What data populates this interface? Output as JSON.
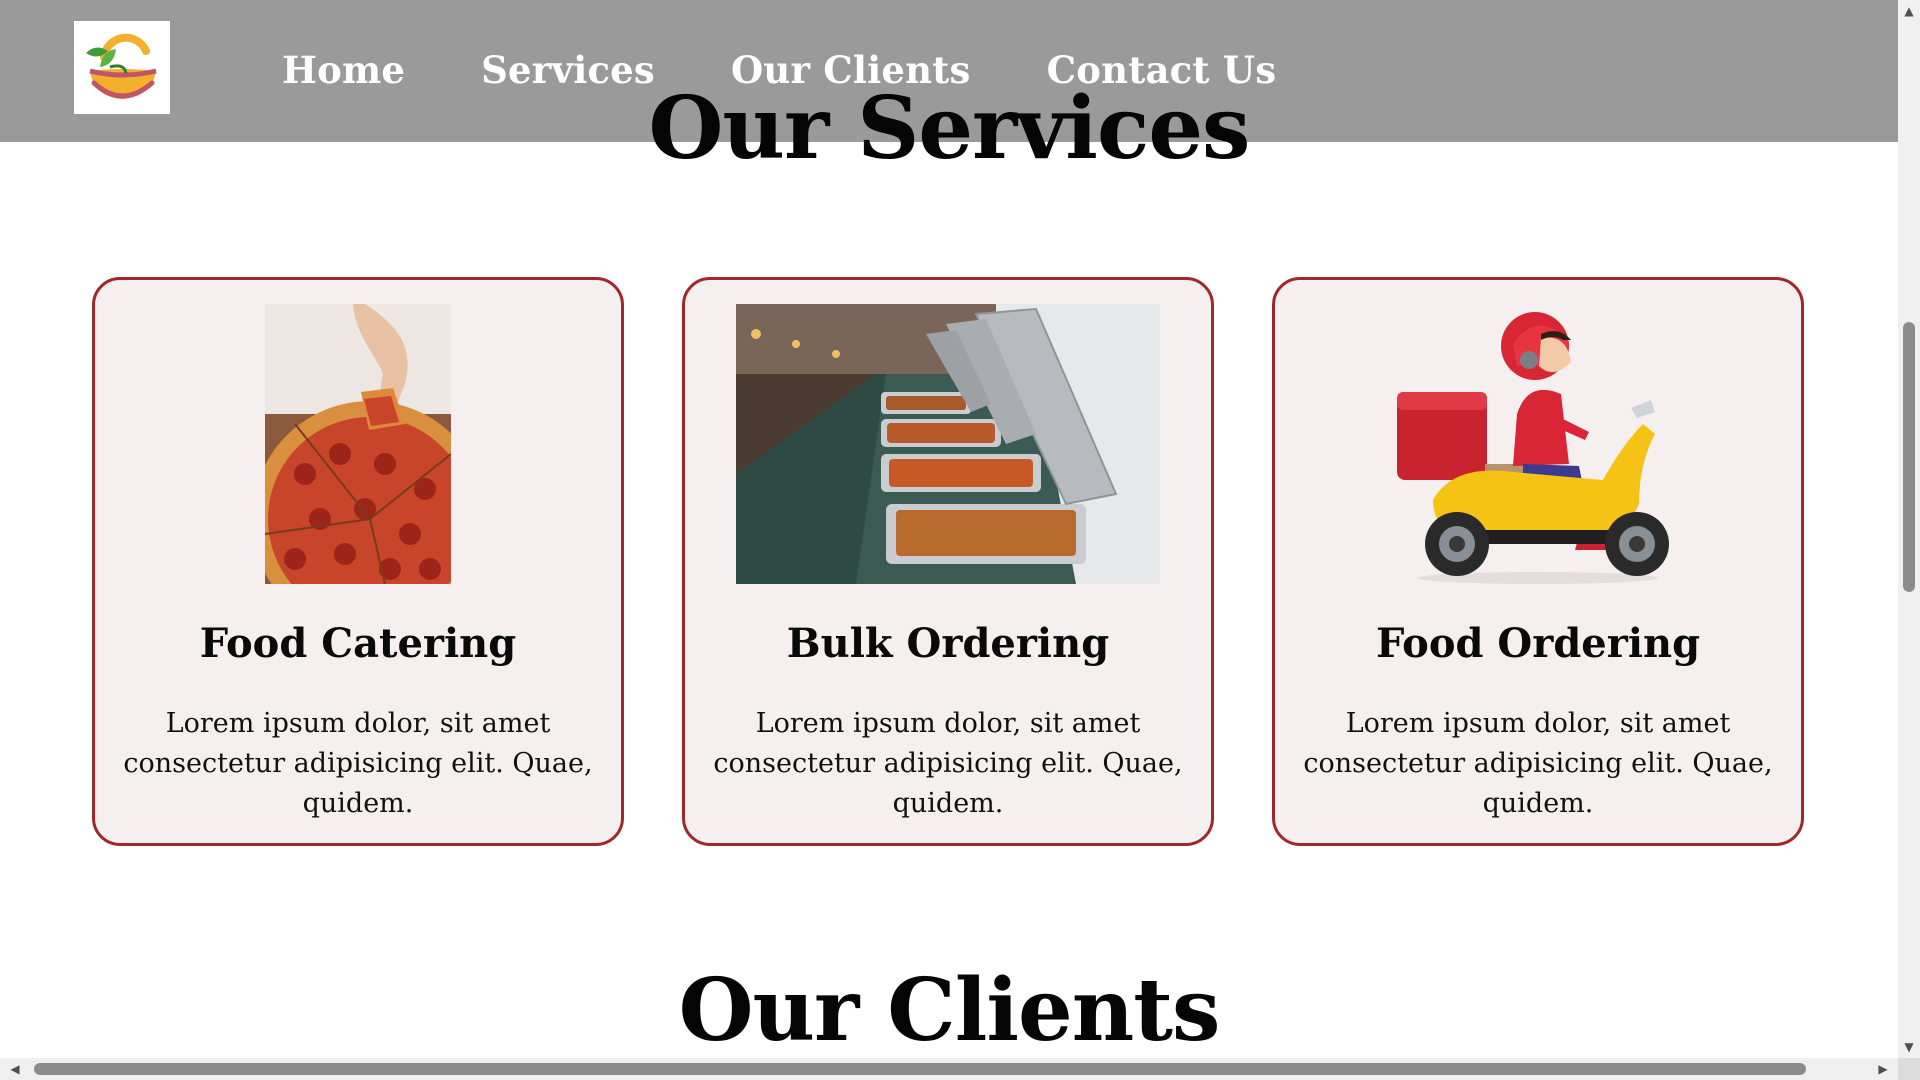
{
  "nav": {
    "links": [
      "Home",
      "Services",
      "Our Clients",
      "Contact Us"
    ]
  },
  "services": {
    "title": "Our Services",
    "cards": [
      {
        "title": "Food Catering",
        "text": "Lorem ipsum dolor, sit amet consectetur adipisicing elit. Quae, quidem.",
        "image": "pizza-photo"
      },
      {
        "title": "Bulk Ordering",
        "text": "Lorem ipsum dolor, sit amet consectetur adipisicing elit. Quae, quidem.",
        "image": "buffet-trays-photo"
      },
      {
        "title": "Food Ordering",
        "text": "Lorem ipsum dolor, sit amet consectetur adipisicing elit. Quae, quidem.",
        "image": "scooter-delivery-illustration"
      }
    ]
  },
  "clients": {
    "title": "Our Clients"
  },
  "colors": {
    "navbar": "#9a9a9a",
    "card_border": "#a0282d",
    "card_bg": "#f5efef"
  }
}
